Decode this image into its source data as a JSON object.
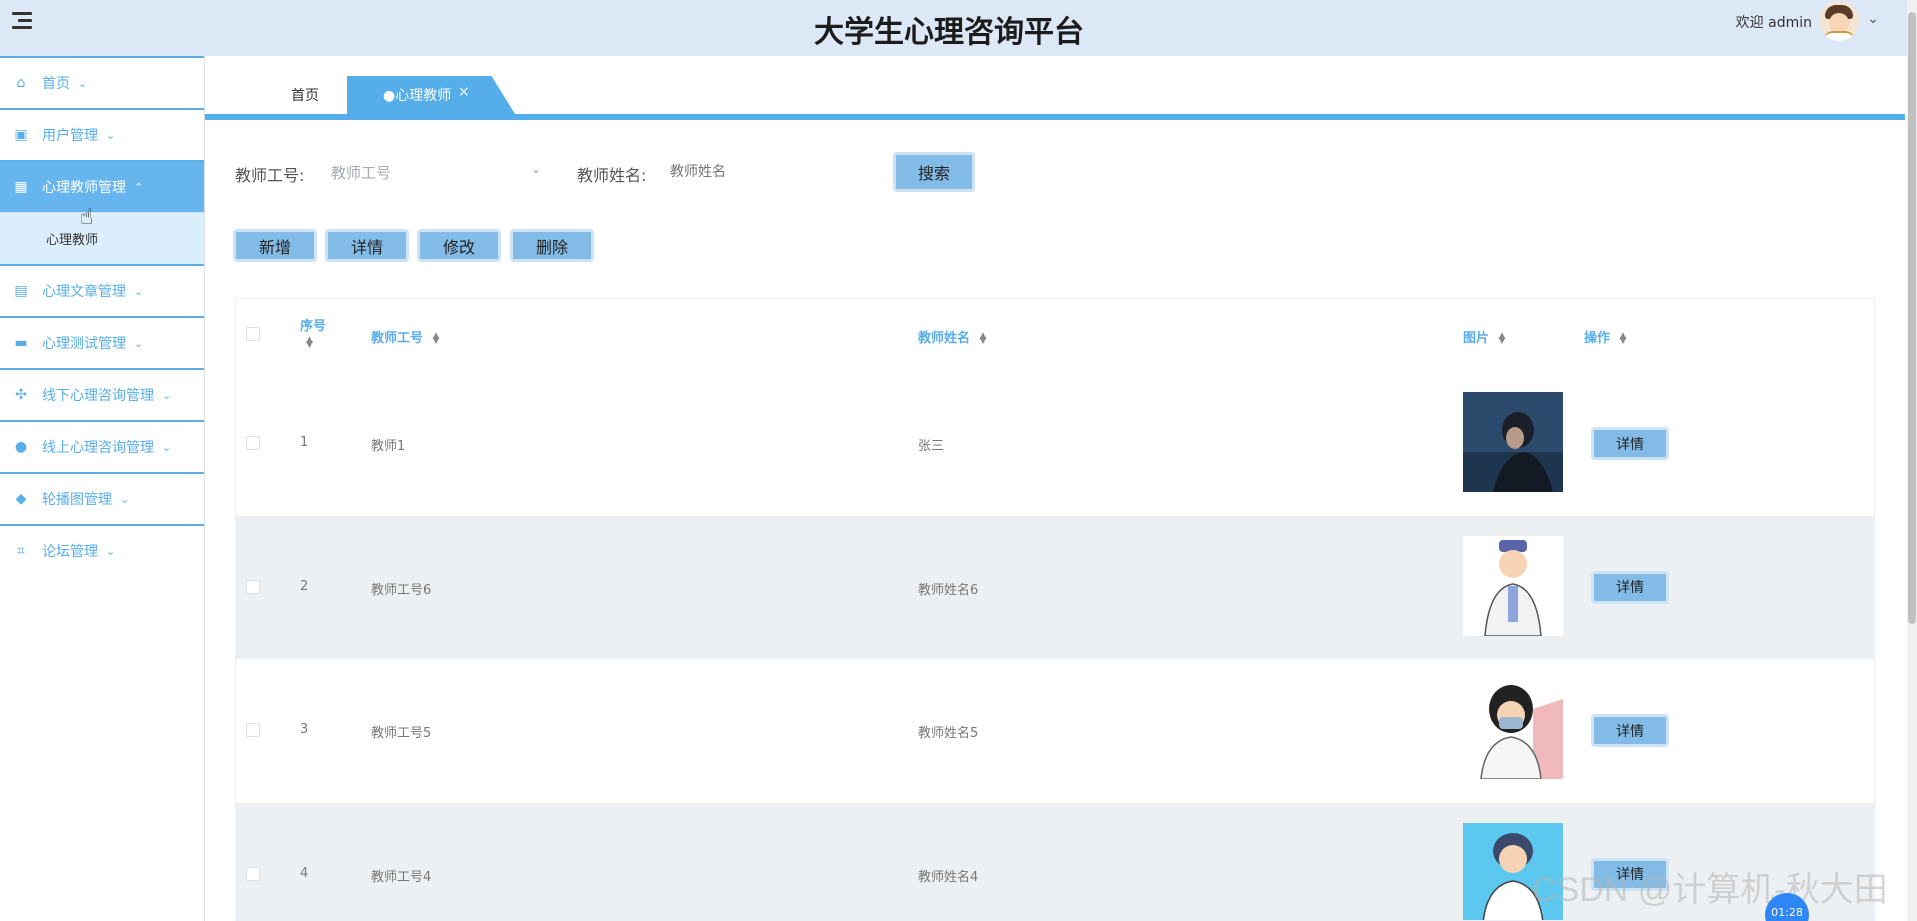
{
  "header": {
    "title": "大学生心理咨询平台",
    "welcome": "欢迎 admin"
  },
  "sidebar": {
    "items": [
      {
        "label": "首页",
        "icon": "home-icon"
      },
      {
        "label": "用户管理",
        "icon": "user-card-icon"
      },
      {
        "label": "心理教师管理",
        "icon": "grid-icon",
        "active": true,
        "sub": [
          "心理教师"
        ]
      },
      {
        "label": "心理文章管理",
        "icon": "briefcase-icon"
      },
      {
        "label": "心理测试管理",
        "icon": "monitor-icon"
      },
      {
        "label": "线下心理咨询管理",
        "icon": "apps-icon"
      },
      {
        "label": "线上心理咨询管理",
        "icon": "chat-icon"
      },
      {
        "label": "轮播图管理",
        "icon": "drop-icon"
      },
      {
        "label": "论坛管理",
        "icon": "crop-icon"
      }
    ]
  },
  "tabs": [
    {
      "label": "首页"
    },
    {
      "label": "●心理教师",
      "closable": true
    }
  ],
  "search": {
    "field1_label": "教师工号:",
    "field1_placeholder": "教师工号",
    "field2_label": "教师姓名:",
    "field2_placeholder": "教师姓名",
    "button": "搜索"
  },
  "actions": [
    "新增",
    "详情",
    "修改",
    "删除"
  ],
  "table": {
    "headers": {
      "index": "序号",
      "teacher_id": "教师工号",
      "teacher_name": "教师姓名",
      "photo": "图片",
      "ops": "操作"
    },
    "rows": [
      {
        "index": "1",
        "teacher_id": "教师1",
        "teacher_name": "张三",
        "photo": "photo-night-portrait",
        "op": "详情"
      },
      {
        "index": "2",
        "teacher_id": "教师工号6",
        "teacher_name": "教师姓名6",
        "photo": "photo-cartoon-doctor",
        "op": "详情"
      },
      {
        "index": "3",
        "teacher_id": "教师工号5",
        "teacher_name": "教师姓名5",
        "photo": "photo-masked-doctor",
        "op": "详情"
      },
      {
        "index": "4",
        "teacher_id": "教师工号4",
        "teacher_name": "教师姓名4",
        "photo": "photo-cartoon-nurse",
        "op": "详情"
      }
    ]
  },
  "overlay": {
    "watermark": "CSDN @计算机-秋大田",
    "timer": "01:28"
  }
}
